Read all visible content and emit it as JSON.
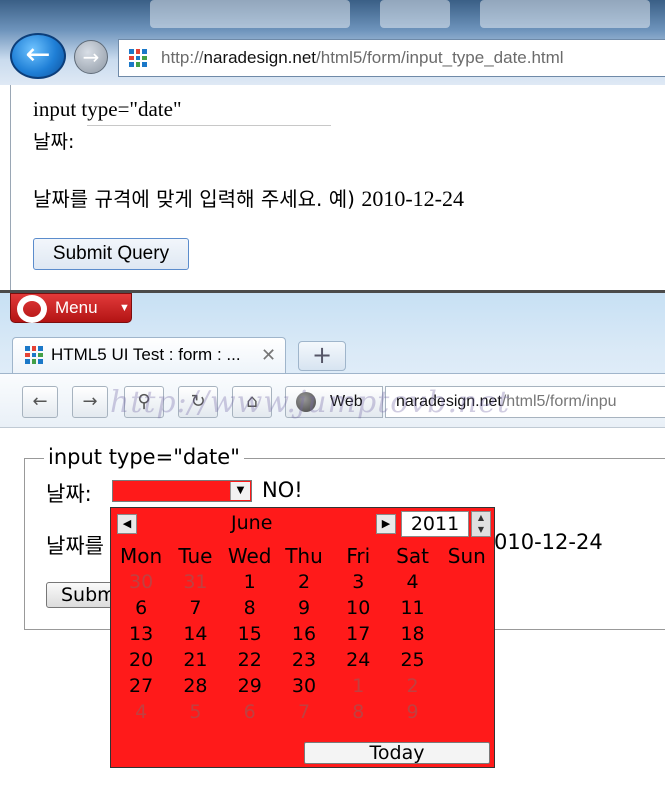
{
  "ie": {
    "address": {
      "domain": "naradesign.net",
      "path": "/html5/form/input_type_date.html",
      "scheme": "http://"
    },
    "form": {
      "legend": "input type=\"date\"",
      "label": "날짜:",
      "help_ko": "날짜를 규격에 맞게 입력해 주세요. 예)",
      "help_example": "2010-12-24",
      "submit": "Submit Query"
    }
  },
  "opera": {
    "menu_label": "Menu",
    "tab_title": "HTML5 UI Test : form : ...",
    "address_search_label": "Web",
    "address": {
      "domain": "naradesign.net",
      "path": "/html5/form/inpu"
    },
    "form": {
      "legend": "input type=\"date\"",
      "label": "날짜:",
      "no_text": "NO!",
      "help_left": "날짜를",
      "help_right": "010-12-24",
      "submit": "Subm"
    },
    "calendar": {
      "month": "June",
      "year": "2011",
      "weekdays": [
        "Mon",
        "Tue",
        "Wed",
        "Thu",
        "Fri",
        "Sat",
        "Sun"
      ],
      "weeks": [
        [
          "30",
          "31",
          "1",
          "2",
          "3",
          "4",
          ""
        ],
        [
          "6",
          "7",
          "8",
          "9",
          "10",
          "11",
          ""
        ],
        [
          "13",
          "14",
          "15",
          "16",
          "17",
          "18",
          ""
        ],
        [
          "20",
          "21",
          "22",
          "23",
          "24",
          "25",
          ""
        ],
        [
          "27",
          "28",
          "29",
          "30",
          "1",
          "2",
          ""
        ],
        [
          "4",
          "5",
          "6",
          "7",
          "8",
          "9",
          ""
        ]
      ],
      "today_label": "Today"
    },
    "select_color": "#ff1a1a"
  },
  "watermark": "http://www.jumptovb.net"
}
